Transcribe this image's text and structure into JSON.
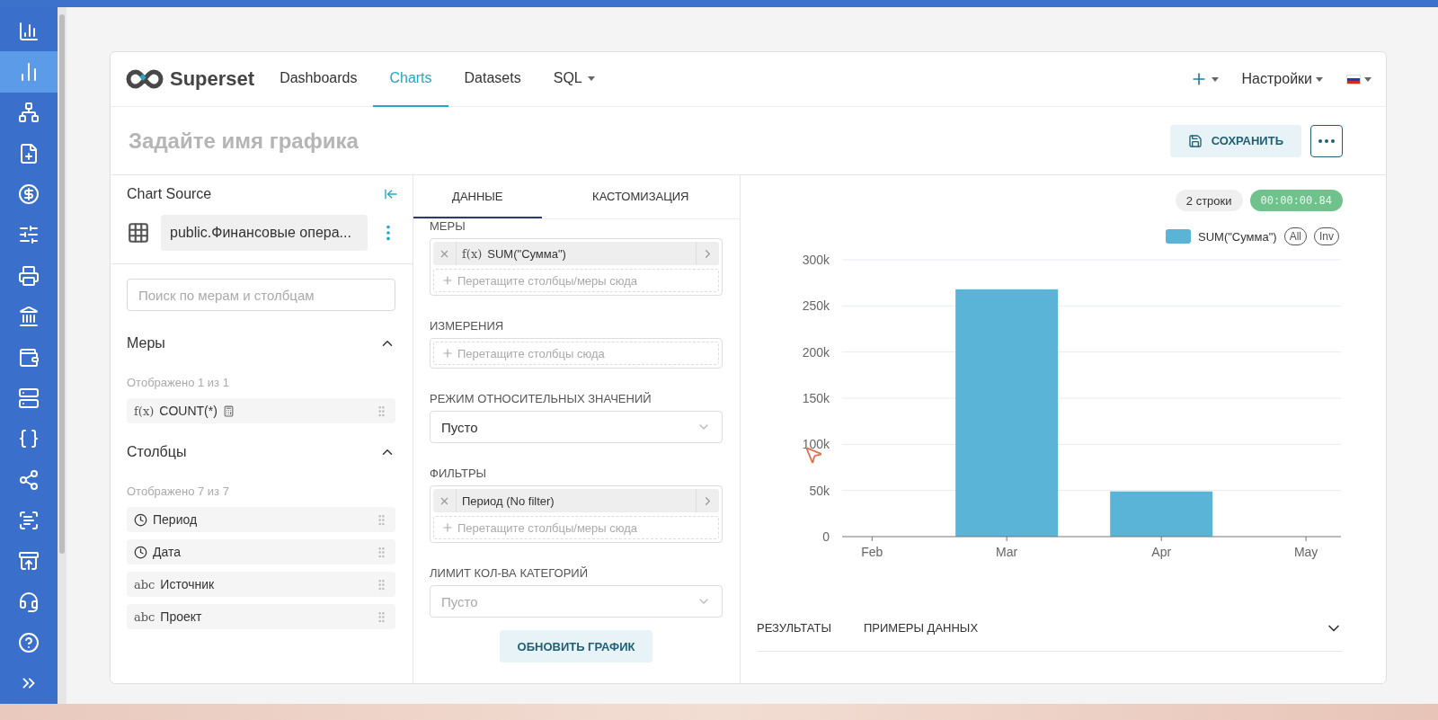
{
  "sidebar": {
    "items": [
      {
        "selected": false
      },
      {
        "selected": true
      },
      {
        "selected": false
      },
      {
        "selected": false
      },
      {
        "selected": false
      },
      {
        "selected": false
      },
      {
        "selected": false
      },
      {
        "selected": false
      },
      {
        "selected": false
      },
      {
        "selected": false
      },
      {
        "selected": false
      },
      {
        "selected": false
      },
      {
        "selected": false
      },
      {
        "selected": false
      },
      {
        "selected": false
      },
      {
        "selected": false
      }
    ]
  },
  "navbar": {
    "brand": "Superset",
    "items": [
      {
        "label": "Dashboards",
        "selected": false,
        "dropdown": false
      },
      {
        "label": "Charts",
        "selected": true,
        "dropdown": false
      },
      {
        "label": "Datasets",
        "selected": false,
        "dropdown": false
      },
      {
        "label": "SQL",
        "selected": false,
        "dropdown": true
      }
    ],
    "settings": "Настройки"
  },
  "chart_title": {
    "placeholder": "Задайте имя графика"
  },
  "save_button": "СОХРАНИТЬ",
  "source_panel": {
    "title": "Chart Source",
    "dataset": "public.Финансовые опера...",
    "search": {
      "placeholder": "Поиск по мерам и столбцам"
    },
    "sections": [
      {
        "title": "Меры",
        "expanded": true,
        "count": "Отображено 1 из 1",
        "items": [
          {
            "kind": "metric",
            "type_label": "f(x)",
            "label": "COUNT(*)"
          }
        ]
      },
      {
        "title": "Столбцы",
        "expanded": true,
        "count": "Отображено 7 из 7",
        "items": [
          {
            "kind": "time",
            "label": "Период"
          },
          {
            "kind": "time",
            "label": "Дата"
          },
          {
            "kind": "text",
            "type_label": "abc",
            "label": "Источник"
          },
          {
            "kind": "text",
            "type_label": "abc",
            "label": "Проект"
          }
        ]
      }
    ]
  },
  "tabs": [
    {
      "label": "ДАННЫЕ",
      "selected": true
    },
    {
      "label": "КАСТОМИЗАЦИЯ",
      "selected": false
    }
  ],
  "controls": [
    {
      "kind": "drop",
      "label": "МЕРЫ",
      "chips": [
        {
          "fx": "f(x)",
          "label": "SUM(\"Сумма\")"
        }
      ],
      "drop_hint": "Перетащите столбцы/меры сюда"
    },
    {
      "kind": "drop",
      "label": "ИЗМЕРЕНИЯ",
      "drop_hint": "Перетащите столбцы сюда"
    },
    {
      "kind": "select",
      "label": "РЕЖИМ ОТНОСИТЕЛЬНЫХ ЗНАЧЕНИЙ",
      "value": "Пусто"
    },
    {
      "kind": "drop",
      "label": "ФИЛЬТРЫ",
      "chips": [
        {
          "label": "Период (No filter)"
        }
      ],
      "drop_hint": "Перетащите столбцы/меры сюда"
    },
    {
      "kind": "select",
      "label": "ЛИМИТ КОЛ-ВА КАТЕГОРИЙ",
      "placeholder": "Пусто"
    }
  ],
  "update_button": "ОБНОВИТЬ ГРАФИК",
  "result_badges": {
    "rows": "2 строки",
    "time": "00:00:00.84"
  },
  "legend": {
    "all": "All",
    "inv": "Inv"
  },
  "chart_data": {
    "type": "bar",
    "categories": [
      "Feb",
      "Mar",
      "Apr",
      "May"
    ],
    "series": [
      {
        "name": "SUM(\"Сумма\")",
        "color": "#5ab4d8",
        "values": [
          null,
          268000,
          49000,
          null
        ]
      }
    ],
    "ylim": [
      0,
      300000
    ],
    "grid": true,
    "yticks": [
      {
        "value": 0,
        "label": "0"
      },
      {
        "value": 50000,
        "label": "50k"
      },
      {
        "value": 100000,
        "label": "100k"
      },
      {
        "value": 150000,
        "label": "150k"
      },
      {
        "value": 200000,
        "label": "200k"
      },
      {
        "value": 250000,
        "label": "250k"
      },
      {
        "value": 300000,
        "label": "300k"
      }
    ]
  },
  "bottom_tabs": [
    {
      "label": "РЕЗУЛЬТАТЫ"
    },
    {
      "label": "ПРИМЕРЫ ДАННЫХ"
    }
  ]
}
